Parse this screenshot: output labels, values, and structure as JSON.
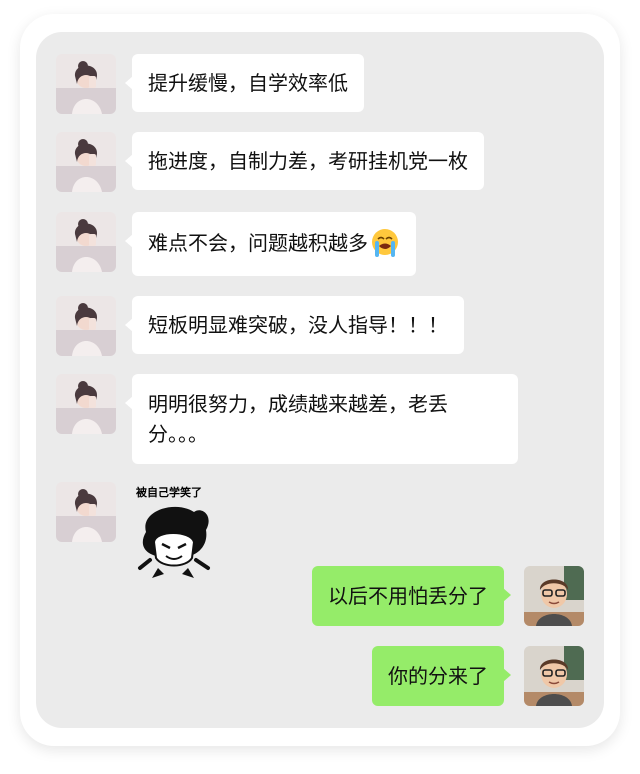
{
  "messages": [
    {
      "side": "in",
      "text": "提升缓慢，自学效率低"
    },
    {
      "side": "in",
      "text": "拖进度，自制力差，考研挂机党一枚"
    },
    {
      "side": "in",
      "text": "难点不会，问题越积越多",
      "emoji": "loudly-crying-emoji"
    },
    {
      "side": "in",
      "text": "短板明显难突破，没人指导！！！"
    },
    {
      "side": "in",
      "text_line1": "明明很努力，成绩越来越差，老丢",
      "text_line2": "分。。。"
    },
    {
      "side": "in",
      "sticker_caption": "被自己学笑了",
      "sticker_icon": "laughing-cartoon-sticker"
    },
    {
      "side": "out",
      "text": "以后不用怕丢分了"
    },
    {
      "side": "out",
      "text": "你的分来了"
    }
  ],
  "colors": {
    "chat_background": "#ebebeb",
    "incoming_bubble": "#ffffff",
    "outgoing_bubble": "#95ec69"
  }
}
